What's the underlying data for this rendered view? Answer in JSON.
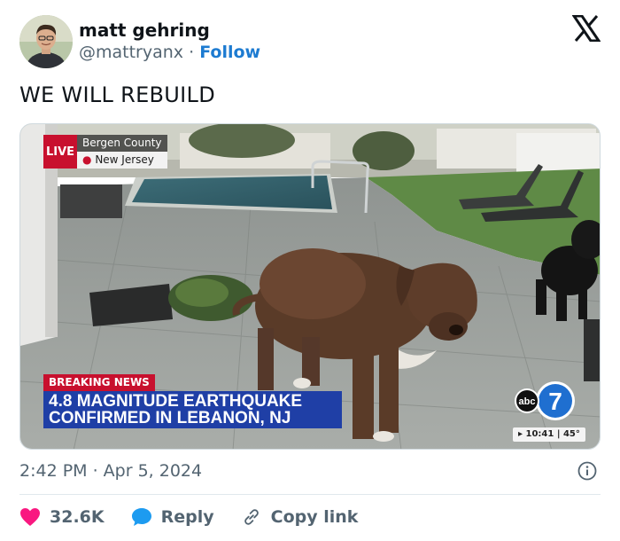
{
  "author": {
    "name": "matt gehring",
    "handle": "@mattryanx",
    "separator": "·",
    "follow_label": "Follow"
  },
  "tweet": {
    "text": "WE WILL REBUILD",
    "timestamp": "2:42 PM · Apr 5, 2024"
  },
  "media": {
    "live_label": "LIVE",
    "location_county": "Bergen County",
    "location_state": "New Jersey",
    "breaking_label": "BREAKING NEWS",
    "headline_line1": "4.8 MAGNITUDE EARTHQUAKE",
    "headline_line2": "CONFIRMED IN LEBANON, NJ",
    "network_logo": "abc",
    "channel_number": "7",
    "time_chip": "▸ 10:41 | 45°"
  },
  "actions": {
    "like_count": "32.6K",
    "reply_label": "Reply",
    "copy_link_label": "Copy link"
  },
  "colors": {
    "follow": "#1d7bd1",
    "like": "#f91880",
    "reply": "#1d9bf0",
    "live_red": "#c8102e",
    "headline_blue": "#1f3fa6"
  },
  "icons": [
    "x-logo-icon",
    "info-icon",
    "heart-icon",
    "reply-bubble-icon",
    "link-icon",
    "location-pin-icon"
  ]
}
